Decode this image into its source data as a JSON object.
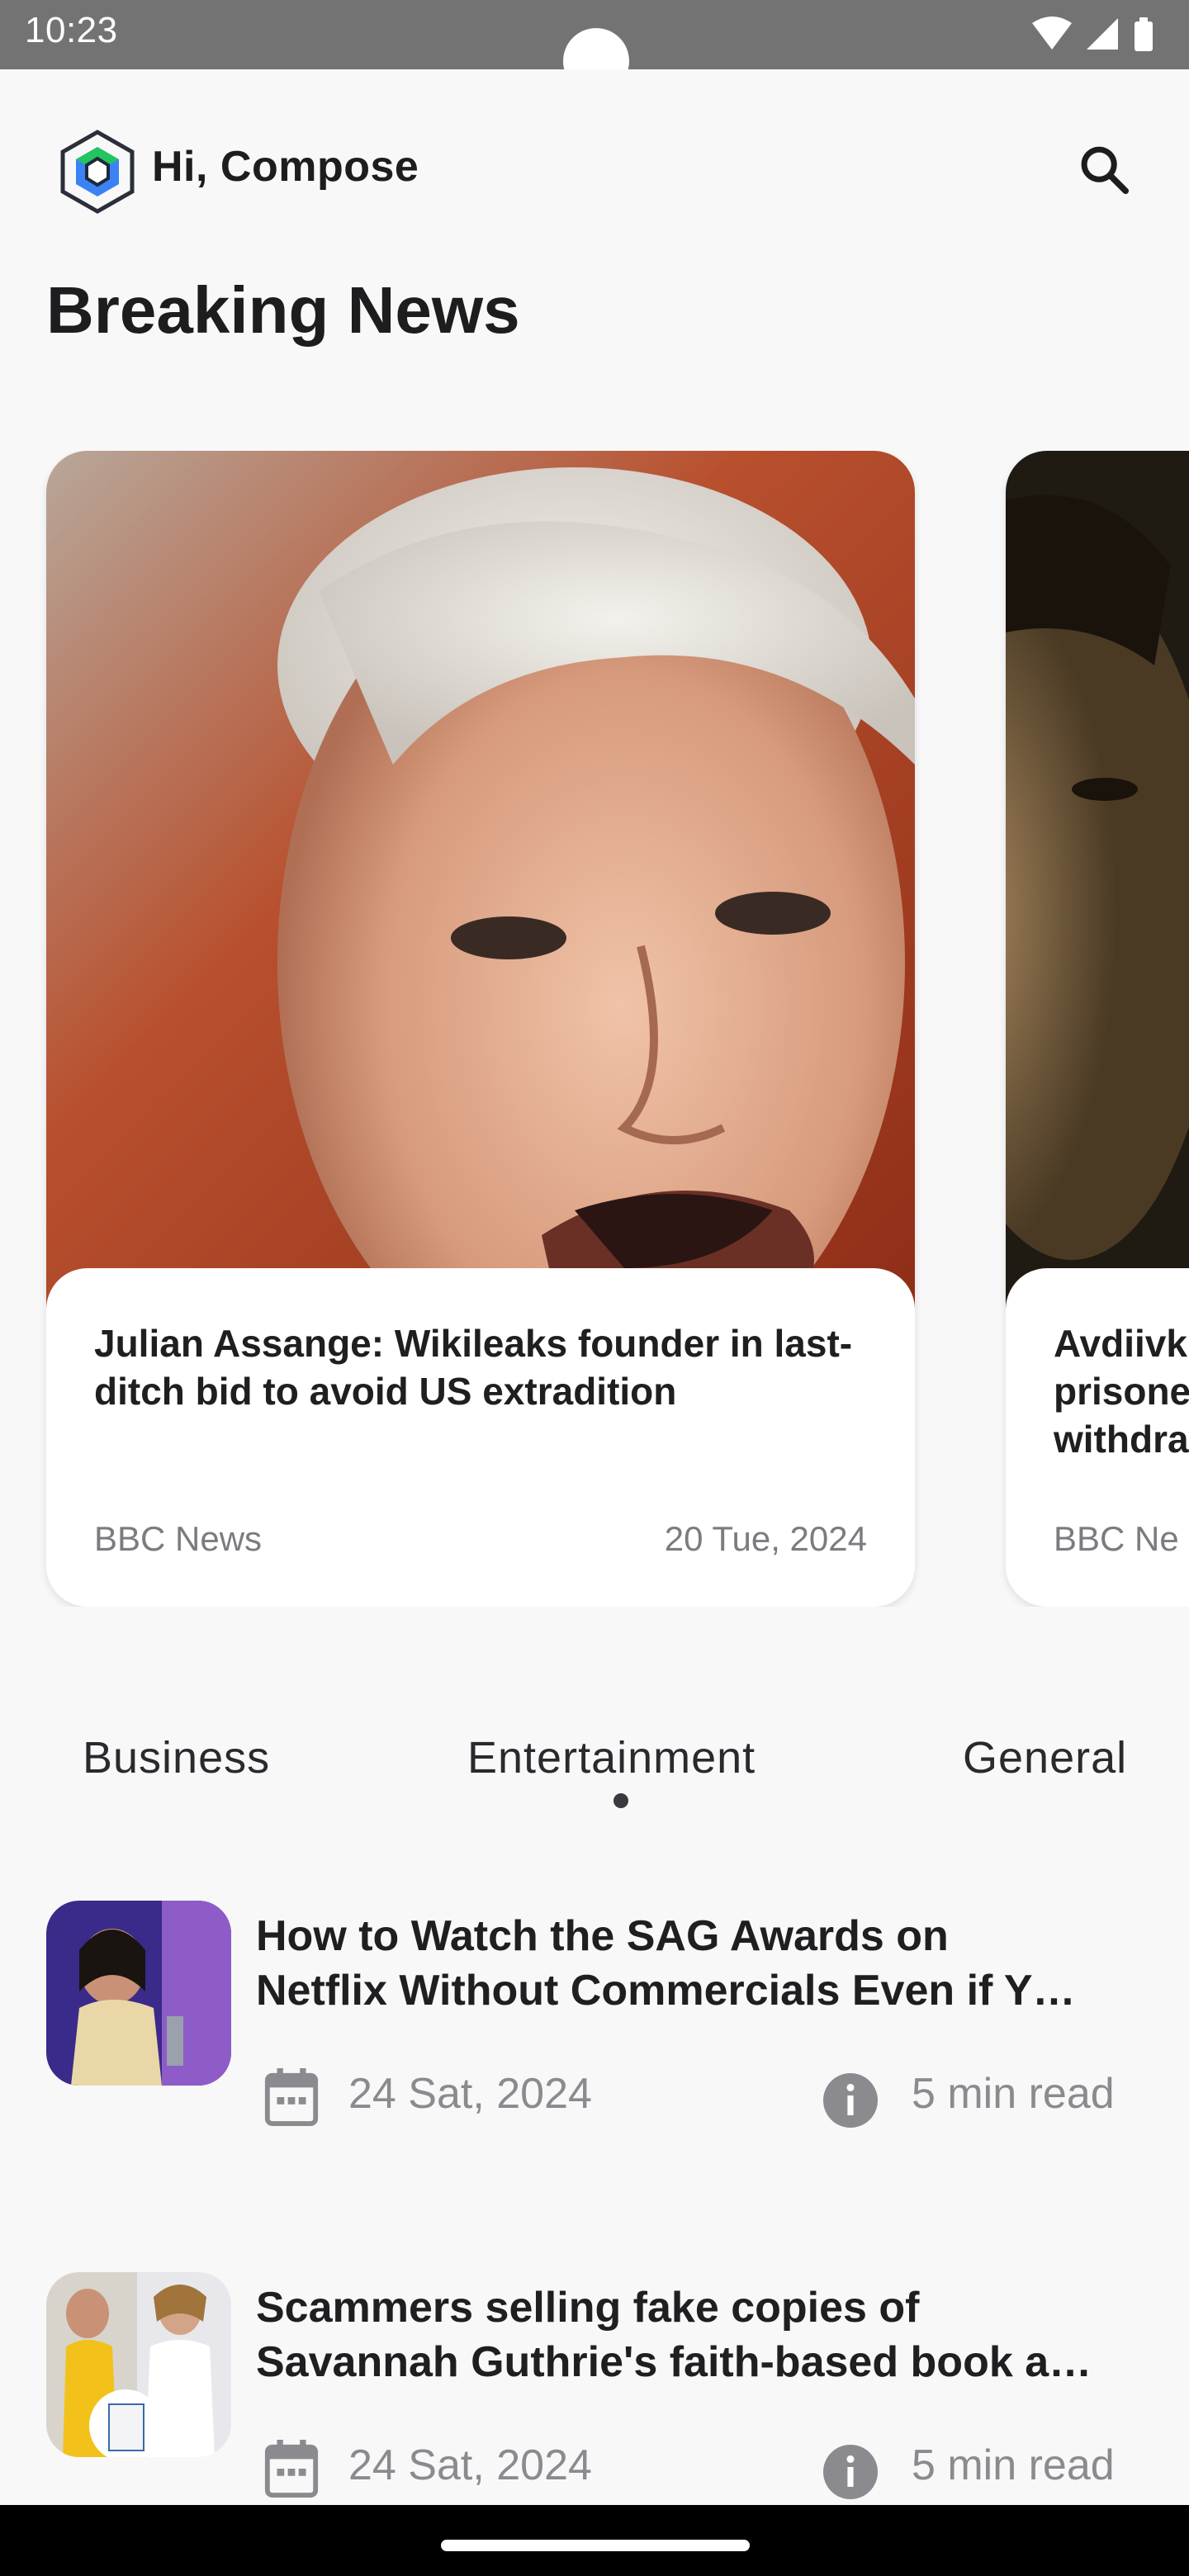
{
  "status_bar": {
    "time": "10:23",
    "icons": [
      "wifi-icon",
      "cellular-signal-icon",
      "battery-icon"
    ]
  },
  "app_bar": {
    "greeting": "Hi, Compose",
    "logo_icon": "hexagon-logo-icon",
    "search_icon": "search-icon"
  },
  "breaking_news": {
    "title": "Breaking News",
    "cards": [
      {
        "title": "Julian Assange: Wikileaks founder in last-ditch bid to avoid US extradition",
        "source": "BBC News",
        "date": "20 Tue, 2024"
      },
      {
        "title": "Avdiivk prisone withdra",
        "source": "BBC Ne",
        "date": ""
      }
    ]
  },
  "tabs": {
    "items": [
      "Business",
      "Entertainment",
      "General"
    ],
    "selected": "Entertainment"
  },
  "news_list": [
    {
      "title_line1": "How to Watch the SAG Awards on",
      "title_line2": "Netflix Without Commercials Even if Y…",
      "date": "24 Sat, 2024",
      "read_time": "5 min read"
    },
    {
      "title_line1": "Scammers selling fake copies of",
      "title_line2": "Savannah Guthrie's faith-based book a…",
      "date": "24 Sat, 2024",
      "read_time": "5 min read"
    }
  ],
  "colors": {
    "background": "#f8f8f9",
    "status_bar": "#737373",
    "text_primary": "#1f1f22",
    "text_secondary": "#8a8a8f"
  }
}
